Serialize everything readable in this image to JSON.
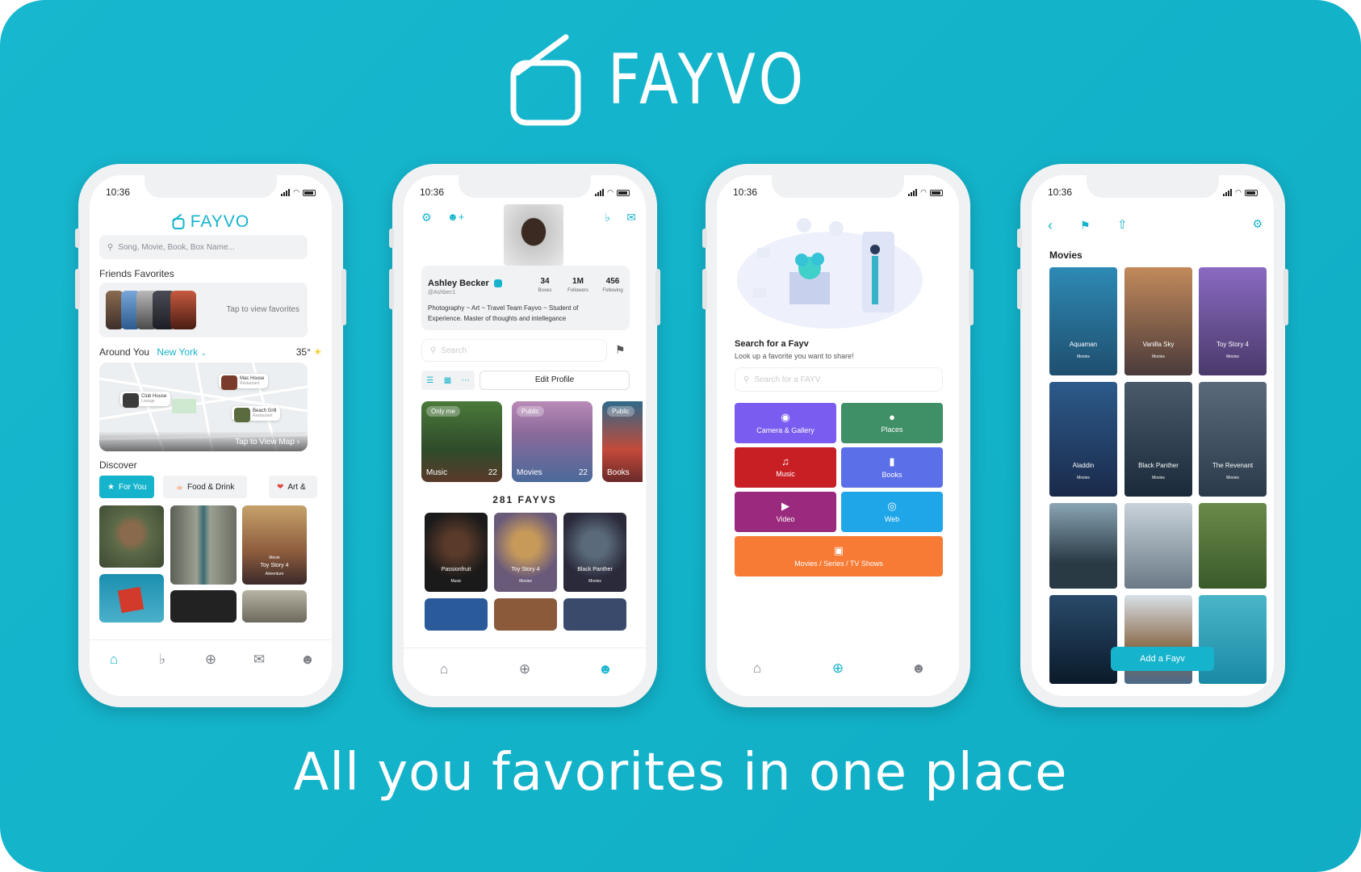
{
  "brand": {
    "name": "FAYVO",
    "tagline": "All you favorites in one place"
  },
  "status": {
    "time": "10:36"
  },
  "phone1": {
    "logo": "FAYVO",
    "search_placeholder": "Song, Movie, Book, Box Name...",
    "friends_title": "Friends Favorites",
    "tap_favorites": "Tap to view favorites",
    "around_label": "Around You",
    "city": "New York",
    "temperature": "35°",
    "map_pins": [
      {
        "name": "Mac House",
        "type": "Restaurant"
      },
      {
        "name": "Club House",
        "type": "Lounge"
      },
      {
        "name": "Beach Grill",
        "type": "Restaurant"
      }
    ],
    "map_cta": "Tap to View Map",
    "discover_title": "Discover",
    "chips": [
      "For You",
      "Food & Drink",
      "Art &"
    ],
    "toy_story": {
      "title": "Toy Story 4",
      "category": "Movie",
      "genre": "Adventure"
    }
  },
  "phone2": {
    "name": "Ashley Becker",
    "handle": "@Ashbec1",
    "stats": [
      {
        "value": "34",
        "label": "Boxes"
      },
      {
        "value": "1M",
        "label": "Followers"
      },
      {
        "value": "456",
        "label": "Following"
      }
    ],
    "bio": "Photography ~ Art ~ Travel Team Fayvo ~ Student of Experience. Master of thoughts and intellegance",
    "search_placeholder": "Search",
    "edit_profile": "Edit Profile",
    "boxes": [
      {
        "tag": "Only me",
        "label": "Music",
        "count": "22"
      },
      {
        "tag": "Public",
        "label": "Movies",
        "count": "22"
      },
      {
        "tag": "Public",
        "label": "Books",
        "count": ""
      }
    ],
    "fayv_count": "281 FAYVS",
    "fayvs": [
      {
        "title": "Passionfruit",
        "category": "Music"
      },
      {
        "title": "Toy Story 4",
        "category": "Movies"
      },
      {
        "title": "Black Panther",
        "category": "Movies"
      }
    ]
  },
  "phone3": {
    "title": "Search for a Fayv",
    "subtitle": "Look up a favorite you want to share!",
    "search_placeholder": "Search for a FAYV",
    "categories": [
      {
        "label": "Camera & Gallery",
        "color": "#7b5cf0",
        "icon": "camera-icon"
      },
      {
        "label": "Places",
        "color": "#3f8f67",
        "icon": "pin-icon"
      },
      {
        "label": "Music",
        "color": "#c81f25",
        "icon": "music-icon"
      },
      {
        "label": "Books",
        "color": "#5b6fe8",
        "icon": "book-icon"
      },
      {
        "label": "Video",
        "color": "#9a2a7d",
        "icon": "video-icon"
      },
      {
        "label": "Web",
        "color": "#1ea6e8",
        "icon": "globe-icon"
      },
      {
        "label": "Movies / Series / TV Shows",
        "color": "#f77b35",
        "icon": "tv-icon"
      }
    ]
  },
  "phone4": {
    "title": "Movies",
    "movies": [
      {
        "title": "Aquaman",
        "category": "Movies"
      },
      {
        "title": "Vanilla Sky",
        "category": "Movies"
      },
      {
        "title": "Toy Story 4",
        "category": "Movies"
      },
      {
        "title": "Aladdin",
        "category": "Movies"
      },
      {
        "title": "Black Panther",
        "category": "Movies"
      },
      {
        "title": "The Revenant",
        "category": "Movies"
      }
    ],
    "add_button": "Add a Fayv"
  },
  "colors": {
    "accent": "#16b4cc",
    "background": "#14b4cb"
  }
}
